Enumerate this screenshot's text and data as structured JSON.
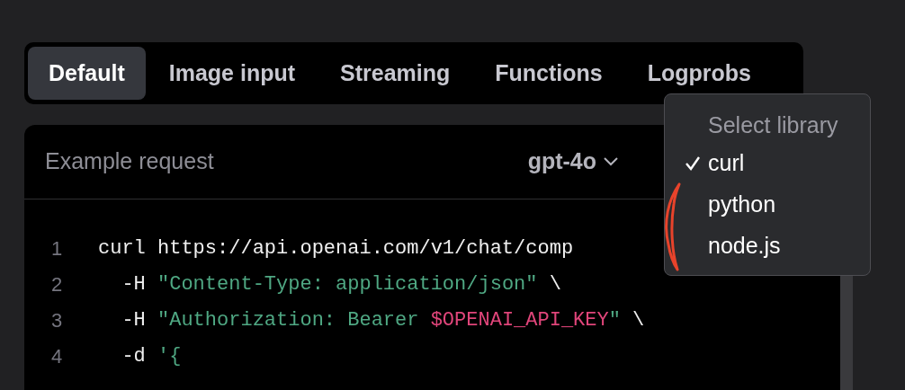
{
  "tabs": [
    {
      "label": "Default",
      "selected": true
    },
    {
      "label": "Image input",
      "selected": false
    },
    {
      "label": "Streaming",
      "selected": false
    },
    {
      "label": "Functions",
      "selected": false
    },
    {
      "label": "Logprobs",
      "selected": false
    }
  ],
  "panel": {
    "title": "Example request",
    "model": "gpt-4o"
  },
  "code_lines": [
    {
      "number": "1",
      "segments": [
        {
          "text": "curl https://api.openai.com/v1/chat/comp",
          "kind": "plain"
        }
      ]
    },
    {
      "number": "2",
      "segments": [
        {
          "text": "  -H ",
          "kind": "plain"
        },
        {
          "text": "\"Content-Type: application/json\"",
          "kind": "string"
        },
        {
          "text": " \\",
          "kind": "plain"
        }
      ]
    },
    {
      "number": "3",
      "segments": [
        {
          "text": "  -H ",
          "kind": "plain"
        },
        {
          "text": "\"Authorization: Bearer ",
          "kind": "string"
        },
        {
          "text": "$OPENAI_API_KEY",
          "kind": "variable"
        },
        {
          "text": "\"",
          "kind": "string"
        },
        {
          "text": " \\",
          "kind": "plain"
        }
      ]
    },
    {
      "number": "4",
      "segments": [
        {
          "text": "  -d ",
          "kind": "plain"
        },
        {
          "text": "'{",
          "kind": "string"
        }
      ]
    }
  ],
  "library_menu": {
    "heading": "Select library",
    "items": [
      {
        "label": "curl",
        "selected": true
      },
      {
        "label": "python",
        "selected": false
      },
      {
        "label": "node.js",
        "selected": false
      }
    ]
  }
}
